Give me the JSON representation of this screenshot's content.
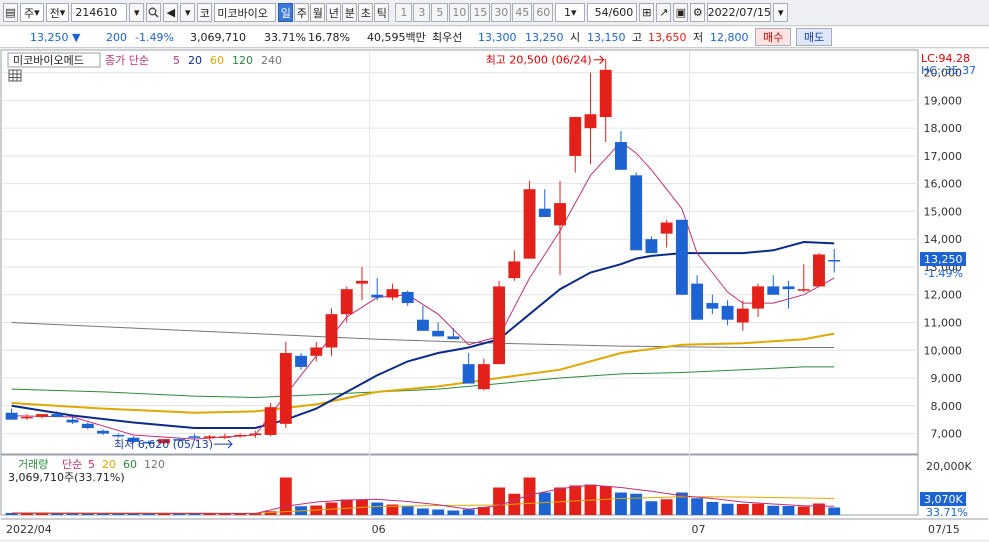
{
  "toolbar": {
    "market": "주",
    "type_label": "전",
    "code": "214610",
    "kind_label": "코",
    "stock_name": "미코바이오",
    "periods": [
      "일",
      "주",
      "월",
      "년",
      "분",
      "초",
      "틱"
    ],
    "active_period": "일",
    "minute_options": [
      "1",
      "3",
      "5",
      "10",
      "15",
      "30",
      "45",
      "60"
    ],
    "minute_value": "1",
    "count": "54/600",
    "date": "2022/07/15"
  },
  "quote": {
    "price": "13,250",
    "change": "200",
    "rate": "-1.49%",
    "volume": "3,069,710",
    "turnover": "33.71%",
    "ratio2": "16.78%",
    "amount": "40,595백만",
    "best_label": "최우선",
    "ask": "13,300",
    "bid": "13,250",
    "open_label": "시",
    "open": "13,150",
    "high_label": "고",
    "high": "13,650",
    "low_label": "저",
    "low": "12,800",
    "buy_label": "매수",
    "sell_label": "매도"
  },
  "price_legend": {
    "name": "미코바이오메드",
    "type": "종가 단순",
    "periods": [
      "5",
      "20",
      "60",
      "120",
      "240"
    ],
    "colors": [
      "#c0307a",
      "#0b2a8a",
      "#e0a800",
      "#2a8a3a",
      "#777777"
    ]
  },
  "volume_legend": {
    "name": "거래량",
    "type": "단순",
    "periods": [
      "5",
      "20",
      "60",
      "120"
    ],
    "colors": [
      "#c0307a",
      "#e0a800",
      "#2a8a3a",
      "#777777"
    ],
    "current": "3,069,710주(33.71%)"
  },
  "annotations": {
    "high": "최고 20,500 (06/24)",
    "low": "최저 6,620 (05/13)"
  },
  "right_axis": {
    "lc": "LC:94.28",
    "hc": "HC:-35.37",
    "price_tag": "13,250",
    "rate_tag": "-1.49%",
    "vol_max": "20,000K",
    "vol_tag": "3,070K",
    "vol_rate": "33.71%"
  },
  "colors": {
    "up": "#e3201a",
    "down": "#1d63d1",
    "grid": "#e4e4e4"
  },
  "chart_data": {
    "type": "candlestick",
    "y_ticks": [
      7000,
      8000,
      9000,
      10000,
      11000,
      12000,
      13000,
      14000,
      15000,
      16000,
      17000,
      18000,
      19000,
      20000
    ],
    "y_tick_labels": [
      "7,000",
      "8,000",
      "9,000",
      "10,000",
      "11,000",
      "12,000",
      "13,000",
      "14,000",
      "15,000",
      "16,000",
      "17,000",
      "18,000",
      "19,000",
      "20,000"
    ],
    "ylim": [
      6300,
      20850
    ],
    "x_labels": [
      {
        "index": 0,
        "label": "2022/04"
      },
      {
        "index": 24,
        "label": "06"
      },
      {
        "index": 45,
        "label": "07"
      },
      {
        "index": 58,
        "label": "07/15"
      }
    ],
    "n_slots": 60,
    "candles": [
      [
        7750,
        7900,
        7500,
        7500,
        0.8
      ],
      [
        7600,
        7700,
        7500,
        7600,
        0.7
      ],
      [
        7600,
        7700,
        7550,
        7700,
        0.7
      ],
      [
        7700,
        7800,
        7600,
        7600,
        0.6
      ],
      [
        7500,
        7600,
        7350,
        7400,
        0.6
      ],
      [
        7350,
        7400,
        7150,
        7200,
        0.5
      ],
      [
        7100,
        7150,
        6950,
        7000,
        0.5
      ],
      [
        6950,
        7000,
        6850,
        6900,
        0.5
      ],
      [
        6850,
        6900,
        6650,
        6700,
        0.5
      ],
      [
        6700,
        6750,
        6620,
        6650,
        0.5
      ],
      [
        6650,
        6800,
        6620,
        6800,
        0.5
      ],
      [
        6800,
        6850,
        6700,
        6750,
        0.5
      ],
      [
        6900,
        7000,
        6750,
        6850,
        0.6
      ],
      [
        6850,
        6950,
        6750,
        6900,
        0.6
      ],
      [
        6900,
        7000,
        6800,
        6900,
        0.6
      ],
      [
        6900,
        7000,
        6850,
        6950,
        0.6
      ],
      [
        6950,
        7100,
        6850,
        7000,
        0.7
      ],
      [
        6950,
        8100,
        6900,
        7950,
        1.5
      ],
      [
        7350,
        10300,
        7200,
        9900,
        15.0
      ],
      [
        9800,
        9900,
        9300,
        9400,
        3.5
      ],
      [
        9800,
        10300,
        9600,
        10100,
        3.8
      ],
      [
        10100,
        11500,
        9800,
        11300,
        5.0
      ],
      [
        11300,
        12300,
        11000,
        12200,
        6.2
      ],
      [
        12400,
        13000,
        11800,
        12500,
        6.0
      ],
      [
        12000,
        12600,
        11800,
        11900,
        5.0
      ],
      [
        11900,
        12400,
        11800,
        12200,
        4.2
      ],
      [
        12100,
        12150,
        11600,
        11700,
        3.4
      ],
      [
        11100,
        11600,
        10900,
        10700,
        2.6
      ],
      [
        10700,
        11000,
        10500,
        10500,
        2.2
      ],
      [
        10500,
        10800,
        10400,
        10400,
        1.8
      ],
      [
        9500,
        9900,
        9000,
        8800,
        2.2
      ],
      [
        8600,
        9700,
        8550,
        9500,
        3.2
      ],
      [
        9500,
        12500,
        9500,
        12300,
        11.0
      ],
      [
        12600,
        13600,
        12500,
        13200,
        8.5
      ],
      [
        13300,
        16100,
        13300,
        15800,
        15.0
      ],
      [
        15100,
        15800,
        15000,
        14800,
        9.0
      ],
      [
        14500,
        16100,
        12700,
        15300,
        11.0
      ],
      [
        17000,
        18400,
        16400,
        18400,
        11.8
      ],
      [
        18000,
        20000,
        16700,
        18500,
        12.2
      ],
      [
        18400,
        20500,
        17500,
        20100,
        11.5
      ],
      [
        17500,
        17900,
        16900,
        16500,
        9.0
      ],
      [
        16300,
        16400,
        13600,
        13600,
        8.5
      ],
      [
        14000,
        14100,
        13600,
        13500,
        5.5
      ],
      [
        14200,
        14700,
        13700,
        14600,
        6.3
      ],
      [
        14700,
        14700,
        12000,
        12000,
        9.0
      ],
      [
        12400,
        12700,
        11300,
        11100,
        6.7
      ],
      [
        11700,
        12000,
        11300,
        11500,
        5.2
      ],
      [
        11600,
        11800,
        10900,
        11100,
        4.5
      ],
      [
        11000,
        11800,
        10700,
        11500,
        4.4
      ],
      [
        11500,
        12400,
        11200,
        12300,
        4.5
      ],
      [
        12300,
        12700,
        12100,
        12000,
        3.7
      ],
      [
        12300,
        12500,
        11500,
        12200,
        3.6
      ],
      [
        12200,
        13100,
        12100,
        12200,
        3.4
      ],
      [
        12300,
        13500,
        12300,
        13450,
        4.6
      ],
      [
        13250,
        13650,
        12800,
        13200,
        3.0
      ]
    ],
    "ma5": [
      [
        0,
        7640
      ],
      [
        4,
        7600
      ],
      [
        8,
        6950
      ],
      [
        12,
        6800
      ],
      [
        16,
        6950
      ],
      [
        18,
        8400
      ],
      [
        20,
        9800
      ],
      [
        22,
        11200
      ],
      [
        24,
        11900
      ],
      [
        26,
        12000
      ],
      [
        28,
        11300
      ],
      [
        30,
        10200
      ],
      [
        32,
        10500
      ],
      [
        34,
        12600
      ],
      [
        36,
        14300
      ],
      [
        38,
        16300
      ],
      [
        40,
        17500
      ],
      [
        41,
        17100
      ],
      [
        42,
        16500
      ],
      [
        44,
        15100
      ],
      [
        45,
        13500
      ],
      [
        46,
        12800
      ],
      [
        47,
        12100
      ],
      [
        48,
        11700
      ],
      [
        49,
        11700
      ],
      [
        50,
        11700
      ],
      [
        52,
        12000
      ],
      [
        54,
        12600
      ]
    ],
    "ma20": [
      [
        0,
        8000
      ],
      [
        4,
        7650
      ],
      [
        8,
        7400
      ],
      [
        12,
        7200
      ],
      [
        16,
        7200
      ],
      [
        18,
        7500
      ],
      [
        20,
        7900
      ],
      [
        22,
        8500
      ],
      [
        24,
        9100
      ],
      [
        26,
        9600
      ],
      [
        28,
        9900
      ],
      [
        30,
        10100
      ],
      [
        32,
        10400
      ],
      [
        34,
        11300
      ],
      [
        36,
        12200
      ],
      [
        38,
        12800
      ],
      [
        40,
        13100
      ],
      [
        41,
        13300
      ],
      [
        42,
        13400
      ],
      [
        44,
        13500
      ],
      [
        46,
        13500
      ],
      [
        48,
        13500
      ],
      [
        50,
        13600
      ],
      [
        52,
        13900
      ],
      [
        54,
        13850
      ]
    ],
    "ma60": [
      [
        0,
        8100
      ],
      [
        6,
        7900
      ],
      [
        12,
        7750
      ],
      [
        16,
        7800
      ],
      [
        20,
        8050
      ],
      [
        24,
        8500
      ],
      [
        28,
        8700
      ],
      [
        32,
        9000
      ],
      [
        36,
        9300
      ],
      [
        40,
        9900
      ],
      [
        44,
        10200
      ],
      [
        48,
        10250
      ],
      [
        52,
        10400
      ],
      [
        54,
        10600
      ]
    ],
    "ma120": [
      [
        0,
        8600
      ],
      [
        6,
        8500
      ],
      [
        12,
        8350
      ],
      [
        16,
        8300
      ],
      [
        20,
        8400
      ],
      [
        24,
        8500
      ],
      [
        28,
        8600
      ],
      [
        32,
        8800
      ],
      [
        36,
        9000
      ],
      [
        40,
        9150
      ],
      [
        44,
        9200
      ],
      [
        48,
        9300
      ],
      [
        52,
        9400
      ],
      [
        54,
        9400
      ]
    ],
    "ma240": [
      [
        0,
        11000
      ],
      [
        8,
        10800
      ],
      [
        16,
        10600
      ],
      [
        24,
        10400
      ],
      [
        32,
        10250
      ],
      [
        40,
        10150
      ],
      [
        48,
        10100
      ],
      [
        54,
        10100
      ]
    ],
    "vol_ma5": [
      [
        0,
        0.7
      ],
      [
        8,
        0.6
      ],
      [
        16,
        0.6
      ],
      [
        18,
        3.5
      ],
      [
        20,
        5.2
      ],
      [
        22,
        6.0
      ],
      [
        24,
        6.3
      ],
      [
        26,
        5.4
      ],
      [
        28,
        4.1
      ],
      [
        30,
        2.3
      ],
      [
        32,
        3.8
      ],
      [
        34,
        8.0
      ],
      [
        36,
        10.5
      ],
      [
        38,
        12.0
      ],
      [
        40,
        11.0
      ],
      [
        42,
        9.5
      ],
      [
        44,
        7.7
      ],
      [
        46,
        6.6
      ],
      [
        48,
        5.2
      ],
      [
        50,
        4.4
      ],
      [
        52,
        3.7
      ],
      [
        54,
        3.5
      ]
    ],
    "vol_ma20": [
      [
        0,
        0.9
      ],
      [
        8,
        0.8
      ],
      [
        16,
        0.7
      ],
      [
        20,
        2.0
      ],
      [
        24,
        3.4
      ],
      [
        28,
        3.8
      ],
      [
        32,
        4.0
      ],
      [
        36,
        5.3
      ],
      [
        40,
        6.6
      ],
      [
        44,
        7.3
      ],
      [
        48,
        7.2
      ],
      [
        52,
        6.8
      ],
      [
        54,
        6.6
      ]
    ]
  }
}
